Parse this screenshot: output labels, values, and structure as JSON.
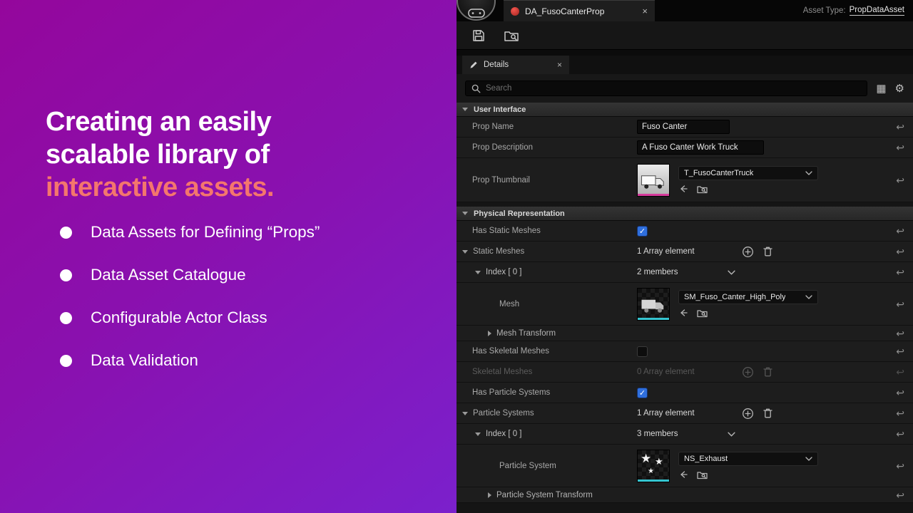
{
  "left_panel": {
    "heading": [
      "Creating an easily",
      "scalable library of",
      "interactive assets."
    ],
    "bullets": [
      "Data Assets for Defining “Props”",
      "Data Asset Catalogue",
      "Configurable Actor Class",
      "Data Validation"
    ],
    "colors": {
      "accent": "#f4766d",
      "bg_top": "#94079c",
      "bg_bottom": "#7b20cc"
    }
  },
  "editor": {
    "tab": {
      "title": "DA_FusoCanterProp",
      "close": "×"
    },
    "asset_type": {
      "label": "Asset Type:",
      "value": "PropDataAsset"
    },
    "details": {
      "title": "Details",
      "close": "×"
    },
    "search": {
      "placeholder": "Search"
    },
    "icons": {
      "gear": "⚙",
      "grid": "▦",
      "reset": "↩",
      "check": "✓",
      "star": "★"
    },
    "sections": {
      "user_interface": {
        "title": "User Interface"
      },
      "physical_representation": {
        "title": "Physical Representation"
      }
    },
    "rows": {
      "prop_name": {
        "label": "Prop Name",
        "value": "Fuso Canter"
      },
      "prop_description": {
        "label": "Prop Description",
        "value": "A Fuso Canter Work Truck"
      },
      "prop_thumbnail": {
        "label": "Prop Thumbnail",
        "asset": "T_FusoCanterTruck"
      },
      "has_static_meshes": {
        "label": "Has Static Meshes",
        "checked": true
      },
      "static_meshes": {
        "label": "Static Meshes",
        "value": "1 Array element"
      },
      "static_meshes_index": {
        "label": "Index [ 0 ]",
        "value": "2 members"
      },
      "mesh": {
        "label": "Mesh",
        "asset": "SM_Fuso_Canter_High_Poly"
      },
      "mesh_transform": {
        "label": "Mesh Transform"
      },
      "has_skeletal_meshes": {
        "label": "Has Skeletal Meshes",
        "checked": false
      },
      "skeletal_meshes": {
        "label": "Skeletal Meshes",
        "value": "0 Array element",
        "disabled": true
      },
      "has_particle_systems": {
        "label": "Has Particle Systems",
        "checked": true
      },
      "particle_systems": {
        "label": "Particle Systems",
        "value": "1 Array element"
      },
      "particle_systems_index": {
        "label": "Index [ 0 ]",
        "value": "3 members"
      },
      "particle_system": {
        "label": "Particle System",
        "asset": "NS_Exhaust"
      },
      "particle_system_transform": {
        "label": "Particle System Transform"
      }
    }
  }
}
